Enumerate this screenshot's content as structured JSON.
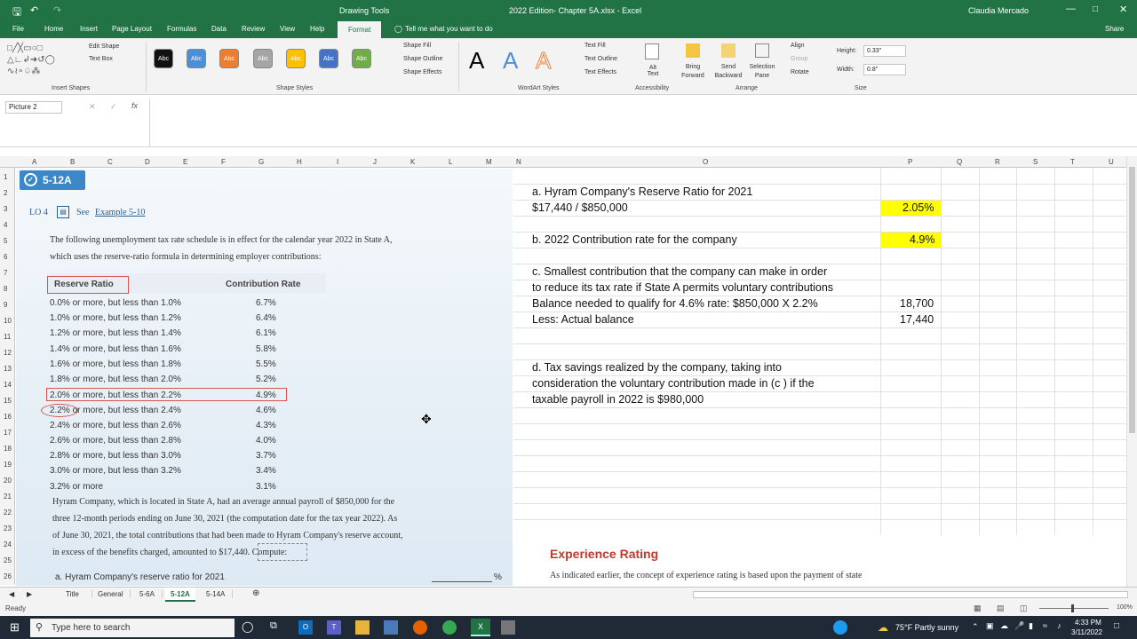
{
  "title_bar": {
    "drawing_tools": "Drawing Tools",
    "doc_title": "2022 Edition- Chapter 5A.xlsx - Excel",
    "user": "Claudia Mercado"
  },
  "tabs": [
    "File",
    "Home",
    "Insert",
    "Page Layout",
    "Formulas",
    "Data",
    "Review",
    "View",
    "Help",
    "Format"
  ],
  "tell_me": "Tell me what you want to do",
  "share": "Share",
  "ribbon": {
    "insert_shapes": {
      "label": "Insert Shapes",
      "edit_shape": "Edit Shape",
      "text_box": "Text Box"
    },
    "shape_styles": {
      "label": "Shape Styles",
      "swatch_text": "Abc",
      "shape_fill": "Shape Fill",
      "shape_outline": "Shape Outline",
      "shape_effects": "Shape Effects"
    },
    "wordart": {
      "label": "WordArt Styles",
      "letter": "A",
      "text_fill": "Text Fill",
      "text_outline": "Text Outline",
      "text_effects": "Text Effects"
    },
    "accessibility": {
      "label": "Accessibility",
      "alt_text": "Alt Text"
    },
    "arrange": {
      "label": "Arrange",
      "bring_forward": "Bring Forward",
      "send_backward": "Send Backward",
      "selection_pane": "Selection Pane",
      "align": "Align",
      "group": "Group",
      "rotate": "Rotate"
    },
    "size": {
      "label": "Size",
      "height_label": "Height:",
      "height": "0.33\"",
      "width_label": "Width:",
      "width": "0.8\""
    }
  },
  "colors": {
    "excel_green": "#217346",
    "swatches": [
      "#111111",
      "#4a90d9",
      "#ed7d31",
      "#a5a5a5",
      "#ffc000",
      "#4472c4",
      "#70ad47"
    ],
    "highlight": "#ffff00",
    "badge": "#3b87c8",
    "heading_red": "#c0392b"
  },
  "name_box": "Picture 2",
  "columns": [
    "A",
    "B",
    "C",
    "D",
    "E",
    "F",
    "G",
    "H",
    "I",
    "J",
    "K",
    "L",
    "M",
    "N",
    "O",
    "P",
    "Q",
    "R",
    "S",
    "T",
    "U"
  ],
  "rows": [
    "1",
    "2",
    "3",
    "4",
    "5",
    "6",
    "7",
    "8",
    "9",
    "10",
    "11",
    "12",
    "13",
    "14",
    "15",
    "16",
    "17",
    "18",
    "19",
    "20",
    "21",
    "22",
    "23",
    "24",
    "25",
    "26"
  ],
  "picture": {
    "badge": "5-12A",
    "lo": "LO 4",
    "see": "See",
    "example": "Example 5-10",
    "intro_line1": "The following unemployment tax rate schedule is in effect for the calendar year 2022 in State A,",
    "intro_line2": "which uses the reserve-ratio formula in determining employer contributions:",
    "header_reserve": "Reserve Ratio",
    "header_contribution": "Contribution Rate",
    "table": [
      {
        "ratio": "0.0% or more, but less than 1.0%",
        "rate": "6.7%"
      },
      {
        "ratio": "1.0% or more, but less than 1.2%",
        "rate": "6.4%"
      },
      {
        "ratio": "1.2% or more, but less than 1.4%",
        "rate": "6.1%"
      },
      {
        "ratio": "1.4% or more, but less than 1.6%",
        "rate": "5.8%"
      },
      {
        "ratio": "1.6% or more, but less than 1.8%",
        "rate": "5.5%"
      },
      {
        "ratio": "1.8% or more, but less than 2.0%",
        "rate": "5.2%"
      },
      {
        "ratio": "2.0% or more, but less than 2.2%",
        "rate": "4.9%"
      },
      {
        "ratio": "2.2% or more, but less than 2.4%",
        "rate": "4.6%"
      },
      {
        "ratio": "2.4% or more, but less than 2.6%",
        "rate": "4.3%"
      },
      {
        "ratio": "2.6% or more, but less than 2.8%",
        "rate": "4.0%"
      },
      {
        "ratio": "2.8% or more, but less than 3.0%",
        "rate": "3.7%"
      },
      {
        "ratio": "3.0% or more, but less than 3.2%",
        "rate": "3.4%"
      },
      {
        "ratio": "3.2% or more",
        "rate": "3.1%"
      }
    ],
    "para1": "Hyram Company, which is located in State A, had an average annual payroll of $850,000 for the",
    "para2": "three 12-month periods ending on June 30, 2021 (the computation date for the tax year 2022). As",
    "para3": "of June 30, 2021, the total contributions that had been made to Hyram Company's reserve account,",
    "para4": "in excess of the benefits charged, amounted to $17,440. Compute:",
    "item_a": "a. Hyram Company's reserve ratio for 2021",
    "pct": "%"
  },
  "sheet": {
    "a_line1": "a. Hyram Company's Reserve Ratio for 2021",
    "a_line2": "$17,440 / $850,000",
    "a_value": "2.05%",
    "b_line": "b. 2022 Contribution rate for the company",
    "b_value": "4.9%",
    "c_line1": "c. Smallest contribution that the company can make in order",
    "c_line2": "to reduce its tax rate if State A permits voluntary contributions",
    "c_line3": "Balance needed to qualify for 4.6% rate: $850,000 X 2.2%",
    "c_value3": "18,700",
    "c_line4": "Less: Actual balance",
    "c_value4": "17,440",
    "d_line1": "d. Tax savings realized by the company, taking into",
    "d_line2": "consideration the voluntary contribution made in (c ) if the",
    "d_line3": "taxable payroll in 2022 is $980,000",
    "exp_title": "Experience Rating",
    "exp_text": "As indicated earlier, the concept of experience rating is based upon the payment of state"
  },
  "sheet_tabs": [
    "Title",
    "General",
    "5-6A",
    "5-12A",
    "5-14A"
  ],
  "status": {
    "ready": "Ready",
    "zoom": "100%"
  },
  "taskbar": {
    "search": "Type here to search",
    "weather": "75°F  Partly sunny",
    "time": "4:33 PM",
    "date": "3/11/2022"
  }
}
